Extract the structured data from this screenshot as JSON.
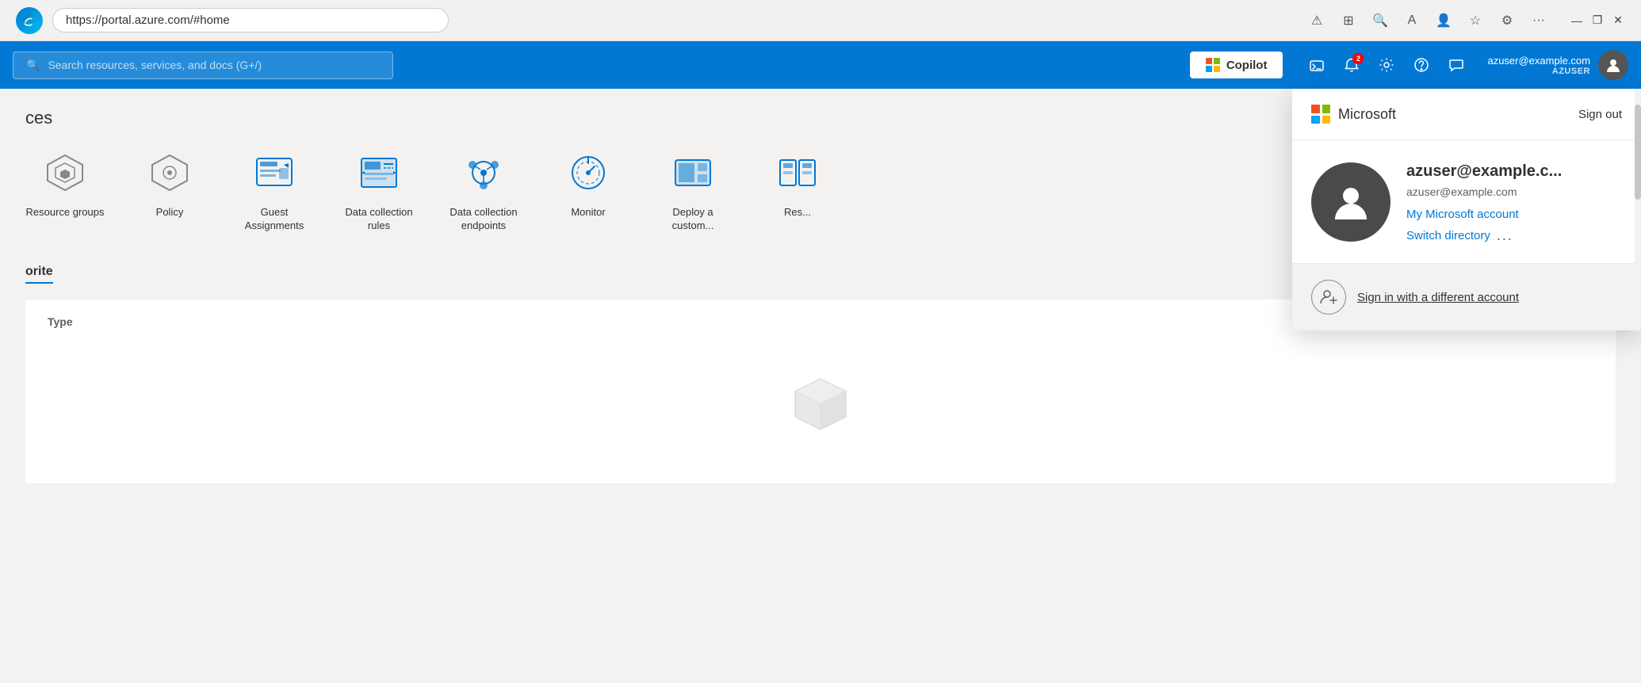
{
  "browser": {
    "address": "https://portal.azure.com/#home",
    "edge_icon": "🌐"
  },
  "topbar": {
    "search_placeholder": "Search resources, services, and docs (G+/)",
    "copilot_label": "Copilot",
    "user_email": "azuser@example.com",
    "user_name": "AZUSER",
    "notification_count": "2"
  },
  "portal": {
    "section_label": "ces",
    "services": [
      {
        "name": "Resource groups",
        "icon": "resource-groups"
      },
      {
        "name": "Policy",
        "icon": "policy"
      },
      {
        "name": "Guest Assignments",
        "icon": "guest-assignments"
      },
      {
        "name": "Data collection rules",
        "icon": "data-collection-rules"
      },
      {
        "name": "Data collection endpoints",
        "icon": "data-collection-endpoints"
      },
      {
        "name": "Monitor",
        "icon": "monitor"
      },
      {
        "name": "Deploy a custom...",
        "icon": "deploy-custom"
      },
      {
        "name": "Res...",
        "icon": "resources"
      }
    ],
    "favorite_tab": "orite",
    "table_column": "Type"
  },
  "account_panel": {
    "ms_logo_label": "Microsoft",
    "sign_out": "Sign out",
    "user_display": "azuser@example.c...",
    "user_email": "azuser@example.com",
    "my_account_link": "My Microsoft account",
    "switch_directory": "Switch directory",
    "more_options": "...",
    "sign_in_different": "Sign in with a different account"
  },
  "colors": {
    "azure_blue": "#0078d4",
    "ms_red": "#f25022",
    "ms_green": "#7fba00",
    "ms_blue": "#00a4ef",
    "ms_yellow": "#ffb900"
  }
}
